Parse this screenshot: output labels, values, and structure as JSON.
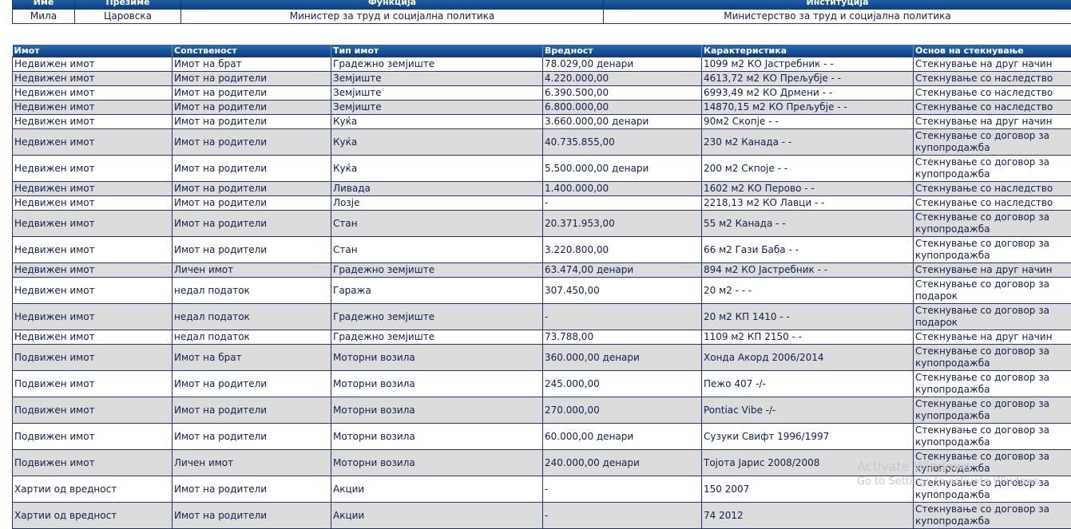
{
  "person": {
    "headers": [
      "Име",
      "Презиме",
      "Функција",
      "Институција"
    ],
    "row": [
      "Мила",
      "Царовска",
      "Министер за труд и социјална политика",
      "Министерство за труд и социјална политика"
    ]
  },
  "assets": {
    "headers": [
      "Имот",
      "Сопственост",
      "Тип имот",
      "Вредност",
      "Карактеристика",
      "Основ на стекнување"
    ],
    "rows": [
      [
        "Недвижен имот",
        "Имот на брат",
        "Градежно земјиште",
        "78.029,00 денари",
        "1099 м2 КО Јастребник - -",
        "Стекнување на друг начин"
      ],
      [
        "Недвижен имот",
        "Имот на родители",
        "Земјиште",
        "4.220.000,00",
        "4613,72 м2 КО Прељубје - -",
        "Стекнување со наследство"
      ],
      [
        "Недвижен имот",
        "Имот на родители",
        "Земјиште",
        "6.390.500,00",
        "6993,49 м2 КО Дрмени - -",
        "Стекнување со наследство"
      ],
      [
        "Недвижен имот",
        "Имот на родители",
        "Земјиште",
        "6.800.000,00",
        "14870,15 м2 КО Прељубје - -",
        "Стекнување со наследство"
      ],
      [
        "Недвижен имот",
        "Имот на родители",
        "Куќа",
        "3.660.000,00 денари",
        "90м2 Скопје - -",
        "Стекнување на друг начин"
      ],
      [
        "Недвижен имот",
        "Имот на родители",
        "Куќа",
        "40.735.855,00",
        "230 м2 Канада - -",
        "Стекнување со договор за купопродажба"
      ],
      [
        "Недвижен имот",
        "Имот на родители",
        "Куќа",
        "5.500.000,00 денари",
        "200 м2 Скпоје - -",
        "Стекнување со договор за купопродажба"
      ],
      [
        "Недвижен имот",
        "Имот на родители",
        "Ливада",
        "1.400.000,00",
        "1602 м2 КО Перово - -",
        "Стекнување со наследство"
      ],
      [
        "Недвижен имот",
        "Имот на родители",
        "Лозје",
        "-",
        "2218,13 м2 КО Лавци - -",
        "Стекнување со наследство"
      ],
      [
        "Недвижен имот",
        "Имот на родители",
        "Стан",
        "20.371.953,00",
        "55 м2 Канада - -",
        "Стекнување со договор за купопродажба"
      ],
      [
        "Недвижен имот",
        "Имот на родители",
        "Стан",
        "3.220.800,00",
        "66 м2 Гази Баба - -",
        "Стекнување со договор за купопродажба"
      ],
      [
        "Недвижен имот",
        "Личен имот",
        "Градежно земјиште",
        "63.474,00 денари",
        "894 м2 КО Јастребник - -",
        "Стекнување на друг начин"
      ],
      [
        "Недвижен имот",
        "недал податок",
        "Гаража",
        "307.450,00",
        "20 м2 - - -",
        "Стекнување со договор за подарок"
      ],
      [
        "Недвижен имот",
        "недал податок",
        "Градежно земјиште",
        "-",
        "20 м2 КП 1410 - -",
        "Стекнување со договор за подарок"
      ],
      [
        "Недвижен имот",
        "недал податок",
        "Градежно земјиште",
        "73.788,00",
        "1109 м2 КП 2150 - -",
        "Стекнување на друг начин"
      ],
      [
        "Подвижен имот",
        "Имот на брат",
        "Моторни возила",
        "360.000,00 денари",
        "Хонда Акорд 2006/2014",
        "Стекнување со договор за купопродажба"
      ],
      [
        "Подвижен имот",
        "Имот на родители",
        "Моторни возила",
        "245.000,00",
        "Пежо 407 -/-",
        "Стекнување со договор за купопродажба"
      ],
      [
        "Подвижен имот",
        "Имот на родители",
        "Моторни возила",
        "270.000,00",
        "Pontiac Vibe -/-",
        "Стекнување со договор за купопродажба"
      ],
      [
        "Подвижен имот",
        "Имот на родители",
        "Моторни возила",
        "60.000,00 денари",
        "Сузуки Свифт 1996/1997",
        "Стекнување со договор за купопродажба"
      ],
      [
        "Подвижен имот",
        "Личен имот",
        "Моторни возила",
        "240.000,00 денари",
        "Тојота Јарис 2008/2008",
        "Стекнување со договор за купопродажба"
      ],
      [
        "Хартии од вредност",
        "Имот на родители",
        "Акции",
        "-",
        "150 2007",
        "Стекнување со договор за купопродажба"
      ],
      [
        "Хартии од вредност",
        "Имот на родители",
        "Акции",
        "-",
        "74 2012",
        "Стекнување со договор за купопродажба"
      ]
    ]
  },
  "watermark": {
    "line1": "Activate Windows",
    "line2": "Go to Settings to activate Windows."
  }
}
